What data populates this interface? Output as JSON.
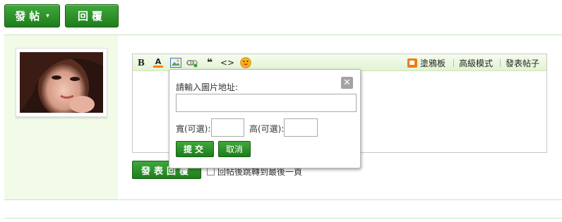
{
  "top_buttons": {
    "post_label": "發帖",
    "post_caret": "▾",
    "reply_label": "回覆"
  },
  "avatar": {
    "icon": "user-photo"
  },
  "toolbar": {
    "bold_label": "B",
    "color_label": "A",
    "color_accent": "#ff7f00",
    "image_icon": "image-icon",
    "link_icon": "link-icon",
    "quote_label": "❝",
    "code_label": "<>",
    "smile_icon": "smiley-icon",
    "doodle_label": "塗鴉板",
    "advanced_label": "高級模式",
    "newpost_label": "發表帖子"
  },
  "reply": {
    "submit_label": "發表回覆",
    "jump_label": "回帖後跳轉到最後一頁"
  },
  "image_dialog": {
    "url_label": "請輸入圖片地址:",
    "url_value": "",
    "width_label": "寬(可選):",
    "width_value": "",
    "height_label": "高(可選):",
    "height_value": "",
    "submit_label": "提交",
    "cancel_label": "取消",
    "close_label": "✕"
  },
  "colors": {
    "button_green": "#2e9a2b",
    "panel_bg": "#f1fbe8",
    "border_green": "#cbe6b8"
  }
}
